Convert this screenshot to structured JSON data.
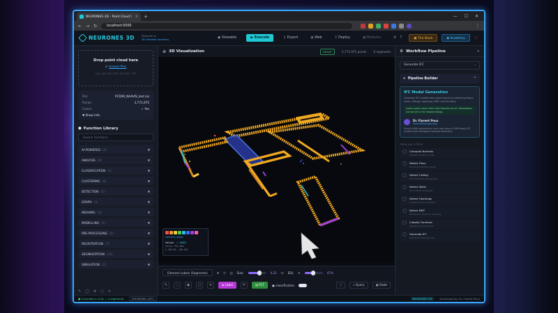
{
  "browser": {
    "tab_title": "NEURONES 3D - Point Cloud I",
    "url": "localhost:5000"
  },
  "header": {
    "logo": "NEURONES 3D",
    "powered_by": "Powered by",
    "powered_org": "3D Geodata Academy",
    "nav": [
      {
        "label": "Viewable",
        "state": "normal"
      },
      {
        "label": "Execute",
        "state": "primary"
      },
      {
        "label": "Export",
        "state": "normal"
      },
      {
        "label": "Web",
        "state": "normal"
      },
      {
        "label": "Deploy",
        "state": "normal"
      },
      {
        "label": "Modules",
        "state": "disabled"
      }
    ],
    "book_label": "The Book",
    "academy_label": "Academy"
  },
  "left": {
    "drop_title": "Drop point cloud here",
    "drop_or": "or",
    "browse": "browse files",
    "formats": "LAS, LAZ, PLY, PCD, XYZ, E57, TXT",
    "file_rows": [
      {
        "label": "File:",
        "value": "PCD09_NAAVIS_test.las"
      },
      {
        "label": "Points:",
        "value": "2,771,975"
      },
      {
        "label": "Colors:",
        "value": "✓ Yes"
      }
    ],
    "show_info": "▼ Show Info",
    "library_title": "Function Library",
    "search_placeholder": "Search functions...",
    "categories": [
      {
        "name": "AI-POWERED",
        "count": "(4)"
      },
      {
        "name": "ANALYSIS",
        "count": "(6)"
      },
      {
        "name": "CLASSIFICATION",
        "count": "(5)"
      },
      {
        "name": "CLUSTERING",
        "count": "(4)"
      },
      {
        "name": "DETECTION",
        "count": "(3)"
      },
      {
        "name": "GRAPH",
        "count": "(3)"
      },
      {
        "name": "MESHING",
        "count": "(4)"
      },
      {
        "name": "MODELLING",
        "count": "(4)"
      },
      {
        "name": "PRE-PROCESSING",
        "count": "(6)"
      },
      {
        "name": "REGISTRATION",
        "count": "(7)"
      },
      {
        "name": "SEGMENTATION",
        "count": "(10)"
      },
      {
        "name": "SIMULATION",
        "count": "(3)"
      }
    ]
  },
  "viz": {
    "title": "3D Visualization",
    "status": "READY",
    "points": "2,771,975 points",
    "segments": "0 segments",
    "legend_label": "element_labels",
    "legend_value_label": "Value:",
    "legend_value": "1.0000",
    "legend_sub1": "Value: Min,Max",
    "legend_sub2": "[-100.00, 100.00]",
    "swatch_colors": [
      "#ff4a4a",
      "#f0a030",
      "#e8d040",
      "#4ad04a",
      "#30c0e0",
      "#3a6aff",
      "#a040e0",
      "#ff5ab0"
    ],
    "render_mode": "Element Labels (Segments)",
    "size_label": "Size:",
    "size_value": "4.22",
    "edl_label": "EDL",
    "opacity_value": "47%",
    "label_btn": "Label",
    "pcf_btn": "PCF",
    "classification_label": "classification",
    "query_btn": "Query",
    "state_btn": "State"
  },
  "right": {
    "title": "Workflow Pipeline",
    "selected_workflow": "Generate IFC",
    "builder_title": "Pipeline Builder",
    "card_title": "IFC Model Generation",
    "card_desc": "Generate IFC models from point clouds by detecting floors, walls, ceilings, openings, MEP, and furniture",
    "card_note": "Load a point cloud, then click Execute to run. Parameters can be set in the module dialog.",
    "author_name": "Dr. Florent Poux",
    "author_handle": "florent@learngeodata",
    "author_bio": "Scan-to-BIM automation: from raw scans to BIM-ready IFC models with intelligent element detection.",
    "steps_title": "PIPELINE STEPS",
    "steps": [
      {
        "name": "Compute Normals",
        "sub": "Estimate surface normals"
      },
      {
        "name": "Detect Floor",
        "sub": "Find horizontal floor planes"
      },
      {
        "name": "Detect Ceiling",
        "sub": "Find horizontal ceiling planes"
      },
      {
        "name": "Detect Walls",
        "sub": "Find vertical wall planes"
      },
      {
        "name": "Detect Openings",
        "sub": "Locate doors and windows"
      },
      {
        "name": "Detect MEP",
        "sub": "Mechanical, electrical, plumbing"
      },
      {
        "name": "Classify Furniture",
        "sub": "Label furniture elements"
      },
      {
        "name": "Generate IFC",
        "sub": "Export IFC building model"
      }
    ]
  },
  "status": {
    "ok": "Complete in 0.6s — 0 segments",
    "chip": "IFM MODEL (IFC)",
    "brand": "NEURONES 3D",
    "credit": "Developed by Dr. Florent Poux"
  }
}
